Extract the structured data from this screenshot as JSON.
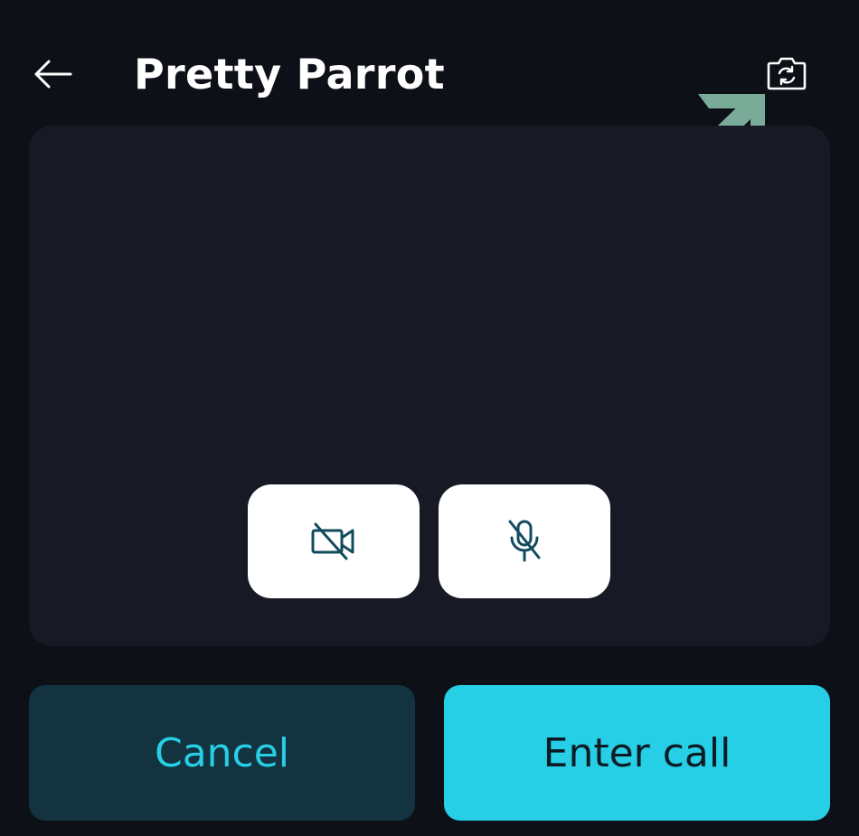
{
  "header": {
    "title": "Pretty Parrot",
    "back_icon": "arrow-left-icon",
    "flip_icon": "camera-flip-icon"
  },
  "preview": {
    "camera_toggle": {
      "icon": "video-off-icon",
      "state": "off"
    },
    "mic_toggle": {
      "icon": "mic-off-icon",
      "state": "off"
    }
  },
  "actions": {
    "cancel_label": "Cancel",
    "enter_label": "Enter call"
  },
  "colors": {
    "background": "#0d1017",
    "panel": "#171a24",
    "accent": "#27cfe6",
    "cancel_bg": "#12333f",
    "icon_dark": "#124b5e",
    "hint_arrow": "#7aab98"
  }
}
